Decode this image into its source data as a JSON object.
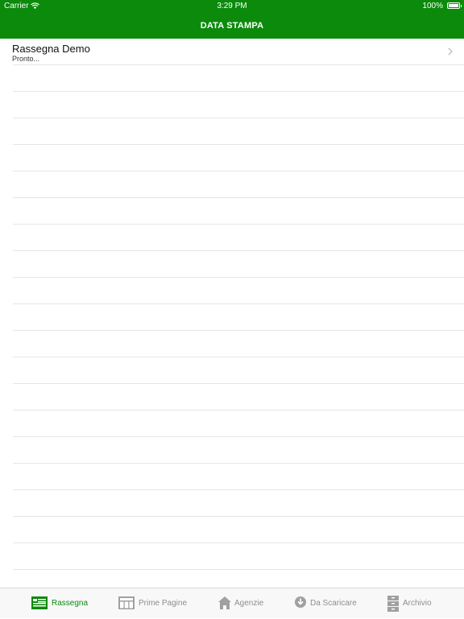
{
  "status_bar": {
    "carrier": "Carrier",
    "time": "3:29 PM",
    "battery": "100%"
  },
  "navbar": {
    "title": "DATA STAMPA"
  },
  "list": {
    "items": [
      {
        "title": "Rassegna Demo",
        "subtitle": "Pronto..."
      }
    ]
  },
  "tabbar": {
    "tabs": [
      {
        "label": "Rassegna",
        "icon": "newspaper-icon",
        "active": true
      },
      {
        "label": "Prime Pagine",
        "icon": "grid-pages-icon",
        "active": false
      },
      {
        "label": "Agenzie",
        "icon": "home-icon",
        "active": false
      },
      {
        "label": "Da Scaricare",
        "icon": "download-icon",
        "active": false
      },
      {
        "label": "Archivio",
        "icon": "archive-icon",
        "active": false
      }
    ]
  },
  "colors": {
    "brand_green": "#0b8a0b",
    "inactive_gray": "#8e8e8e"
  }
}
